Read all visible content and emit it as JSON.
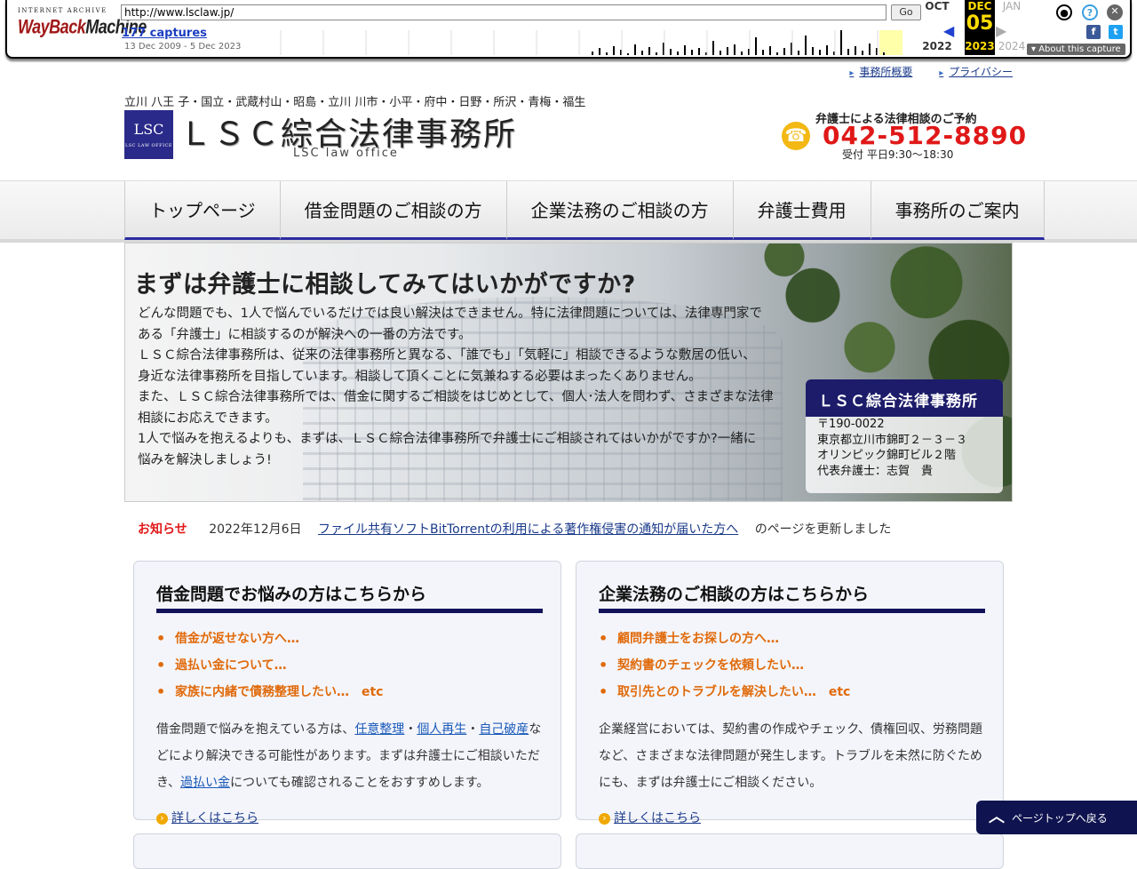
{
  "wayback": {
    "logo_top": "INTERNET ARCHIVE",
    "logo_main_a": "WayBack",
    "logo_main_b": "Machine",
    "url": "http://www.lsclaw.jp/",
    "go_label": "Go",
    "captures": "177 captures",
    "range": "13 Dec 2009 - 5 Dec 2023",
    "prev_month": "OCT",
    "cur_month": "DEC",
    "next_month": "JAN",
    "cur_day": "05",
    "prev_year": "2022",
    "cur_year": "2023",
    "next_year": "2024",
    "about": "About this capture"
  },
  "toplinks": [
    "事務所概要",
    "プライバシー"
  ],
  "header": {
    "tagline": "立川 八王 子・国立・武蔵村山・昭島・立川 川市・小平・府中・日野・所沢・青梅・福生",
    "brand_mark": "LSC",
    "brand_mark_small": "LSC LAW OFFICE",
    "brand_name": "ＬＳＣ綜合法律事務所",
    "brand_sub": "LSC law office",
    "tel_lead": "弁護士による法律相談のご予約",
    "tel_number": "042-512-8890",
    "tel_hours": "受付 平日9:30〜18:30"
  },
  "nav": [
    "トップページ",
    "借金問題のご相談の方",
    "企業法務のご相談の方",
    "弁護士費用",
    "事務所のご案内"
  ],
  "hero": {
    "title": "まずは弁護士に相談してみてはいかがですか?",
    "lines": [
      "どんな問題でも、1人で悩んでいるだけでは良い解決はできません。特に法律問題については、法律専門家で",
      "ある「弁護士」に相談するのが解決への一番の方法です。",
      "ＬＳＣ綜合法律事務所は、従来の法律事務所と異なる、「誰でも」「気軽に」相談できるような敷居の低い、",
      "身近な法律事務所を目指しています。相談して頂くことに気兼ねする必要はまったくありません。",
      "また、ＬＳＣ綜合法律事務所では、借金に関するご相談をはじめとして、個人･法人を問わず、さまざまな法律",
      "相談にお応えできます。",
      "1人で悩みを抱えるよりも、まずは、ＬＳＣ綜合法律事務所で弁護士にご相談されてはいかがですか?一緒に",
      "悩みを解決しましょう!"
    ],
    "box_title": "ＬＳＣ綜合法律事務所",
    "box_lines": [
      "〒190-0022",
      "東京都立川市錦町２－３－３",
      "オリンピック錦町ビル２階",
      "代表弁護士：志賀　貴"
    ]
  },
  "news": {
    "tag": "お知らせ",
    "date": "2022年12月6日",
    "link": "ファイル共有ソフトBitTorrentの利用による著作権侵害の通知が届いた方へ",
    "rest": "のページを更新しました"
  },
  "cards": [
    {
      "title": "借金問題でお悩みの方はこちらから",
      "items": [
        "借金が返せない方へ…",
        "過払い金について…",
        "家族に内緒で債務整理したい…　etc"
      ],
      "text_a": "借金問題で悩みを抱えている方は、",
      "link1": "任意整理",
      "sep1": "・",
      "link2": "個人再生",
      "sep2": "・",
      "link3": "自己破産",
      "text_b": "などにより解決できる可能性があります。まずは弁護士にご相談いただき、",
      "link4": "過払い金",
      "text_c": "についても確認されることをおすすめします。",
      "more": "詳しくはこちら"
    },
    {
      "title": "企業法務のご相談の方はこちらから",
      "items": [
        "顧問弁護士をお探しの方へ…",
        "契約書のチェックを依頼したい…",
        "取引先とのトラブルを解決したい…　etc"
      ],
      "text": "企業経営においては、契約書の作成やチェック、債権回収、労務問題など、さまざまな法律問題が発生します。トラブルを未然に防ぐためにも、まずは弁護士にご相談ください。",
      "more": "詳しくはこちら"
    }
  ],
  "pagetop": "ページトップへ戻る"
}
